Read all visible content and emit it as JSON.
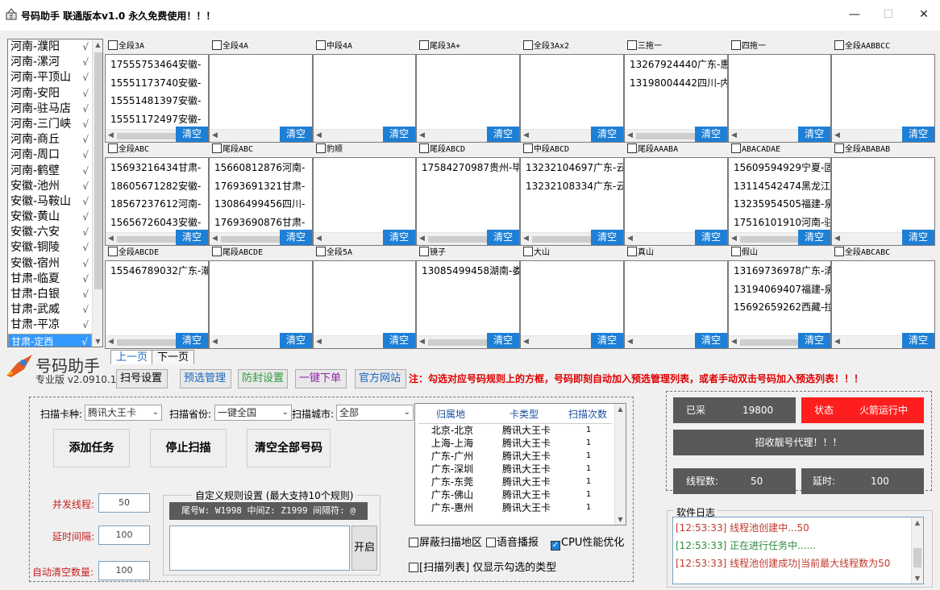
{
  "window": {
    "title": "号码助手 联通版本v1.0 永久免费使用！！！"
  },
  "regions": [
    "河南-濮阳",
    "河南-漯河",
    "河南-平顶山",
    "河南-安阳",
    "河南-驻马店",
    "河南-三门峡",
    "河南-商丘",
    "河南-周口",
    "河南-鹤壁",
    "安徽-池州",
    "安徽-马鞍山",
    "安徽-黄山",
    "安徽-六安",
    "安徽-铜陵",
    "安徽-宿州",
    "甘肃-临夏",
    "甘肃-白银",
    "甘肃-武威",
    "甘肃-平凉",
    "甘肃-定西"
  ],
  "region_check": "√",
  "selected_region": "甘肃-定西",
  "clear_label": "清空",
  "cells": [
    {
      "label": "全段3A",
      "numbers": [
        "17555753464安徽-",
        "15551173740安徽-",
        "15551481397安徽-",
        "15551172497安徽-"
      ]
    },
    {
      "label": "全段4A",
      "numbers": []
    },
    {
      "label": "中段4A",
      "numbers": []
    },
    {
      "label": "尾段3A+",
      "numbers": []
    },
    {
      "label": "全段3Ax2",
      "numbers": []
    },
    {
      "label": "三拖一",
      "numbers": [
        "13267924440广东-惠",
        "13198004442四川-内"
      ]
    },
    {
      "label": "四拖一",
      "numbers": []
    },
    {
      "label": "全段AABBCC",
      "numbers": []
    },
    {
      "label": "全段ABC",
      "numbers": [
        "15693216434甘肃-",
        "18605671282安徽-",
        "18567237612河南-",
        "15656726043安徽-"
      ]
    },
    {
      "label": "尾段ABC",
      "numbers": [
        "15660812876河南-",
        "17693691321甘肃-",
        "13086499456四川-",
        "17693690876甘肃-"
      ]
    },
    {
      "label": "豹顺",
      "numbers": []
    },
    {
      "label": "尾段ABCD",
      "numbers": [
        "17584270987贵州-毕"
      ]
    },
    {
      "label": "中段ABCD",
      "numbers": [
        "13232104697广东-云",
        "13232108334广东-云"
      ]
    },
    {
      "label": "尾段AAABA",
      "numbers": []
    },
    {
      "label": "ABACADAE",
      "numbers": [
        "15609594929宁夏-固",
        "13114542474黑龙江-",
        "13235954505福建-泉",
        "17516101910河南-驻"
      ]
    },
    {
      "label": "全段ABABAB",
      "numbers": []
    },
    {
      "label": "全段ABCDE",
      "numbers": [
        "15546789032广东-潮"
      ]
    },
    {
      "label": "尾段ABCDE",
      "numbers": []
    },
    {
      "label": "全段5A",
      "numbers": []
    },
    {
      "label": "镜子",
      "numbers": [
        "13085499458湖南-娄"
      ]
    },
    {
      "label": "大山",
      "numbers": []
    },
    {
      "label": "真山",
      "numbers": []
    },
    {
      "label": "假山",
      "numbers": [
        "13169736978广东-清",
        "13194069407福建-泉",
        "15692659262西藏-拉"
      ]
    },
    {
      "label": "全段ABCABC",
      "numbers": []
    }
  ],
  "tabs": {
    "prev": "上一页",
    "next": "下一页"
  },
  "logo": {
    "name": "号码助手",
    "edition": "专业版 v2.0910.1"
  },
  "toolbar": {
    "scan_settings": "扫号设置",
    "preselect": "预选管理",
    "anti_block": "防封设置",
    "one_click": "一键下单",
    "website": "官方网站",
    "notice": "注：勾选对应号码规则上的方框，号码即刻自动加入预选管理列表，或者手动双击号码加入预选列表！！！"
  },
  "scan": {
    "card_type_label": "扫描卡种:",
    "card_type_value": "腾讯大王卡",
    "province_label": "扫描省份:",
    "province_value": "一键全国",
    "city_label": "扫描城市:",
    "city_value": "全部"
  },
  "actions": {
    "add_task": "添加任务",
    "stop_scan": "停止扫描",
    "clear_all": "清空全部号码"
  },
  "params": {
    "threads_label": "并发线程:",
    "threads_value": "50",
    "delay_label": "延时间隔:",
    "delay_value": "100",
    "autoclear_label": "自动清空数量:",
    "autoclear_value": "100"
  },
  "custom_rule": {
    "title": "自定义规则设置 (最大支持10个规则)",
    "hint": "尾号W: W1998 中间Z: Z1999 间隔符: @",
    "open_button": "开启"
  },
  "table": {
    "headers": [
      "归属地",
      "卡类型",
      "扫描次数"
    ],
    "rows": [
      [
        "北京-北京",
        "腾讯大王卡",
        "1"
      ],
      [
        "上海-上海",
        "腾讯大王卡",
        "1"
      ],
      [
        "广东-广州",
        "腾讯大王卡",
        "1"
      ],
      [
        "广东-深圳",
        "腾讯大王卡",
        "1"
      ],
      [
        "广东-东莞",
        "腾讯大王卡",
        "1"
      ],
      [
        "广东-佛山",
        "腾讯大王卡",
        "1"
      ],
      [
        "广东-惠州",
        "腾讯大王卡",
        "1"
      ]
    ]
  },
  "options": {
    "block_region": "屏蔽扫描地区",
    "voice": "语音播报",
    "cpu": "CPU性能优化",
    "show_selected": "[扫描列表] 仅显示勾选的类型",
    "cpu_checked": true
  },
  "status": {
    "collected_label": "已采",
    "collected_value": "19800",
    "state_label": "状态",
    "state_value": "火箭运行中",
    "agent_banner": "招收靓号代理！！！",
    "thread_label": "线程数:",
    "thread_value": "50",
    "delay_label": "延时:",
    "delay_value": "100"
  },
  "log": {
    "title": "软件日志",
    "lines": [
      {
        "text": "[12:53:33] 线程池创建中...50",
        "color": "#c0392b"
      },
      {
        "text": "[12:53:33] 正在进行任务中......",
        "color": "#2e8b3e"
      },
      {
        "text": "[12:53:33] 线程池创建成功|当前最大线程数为50",
        "color": "#c0392b"
      }
    ]
  },
  "colors": {
    "accent": "#1e7fd6",
    "danger": "#ff2020",
    "dark": "#595959",
    "notice": "#e00000"
  },
  "icons": {
    "app": "app-icon",
    "rocket": "rocket-logo-icon"
  }
}
